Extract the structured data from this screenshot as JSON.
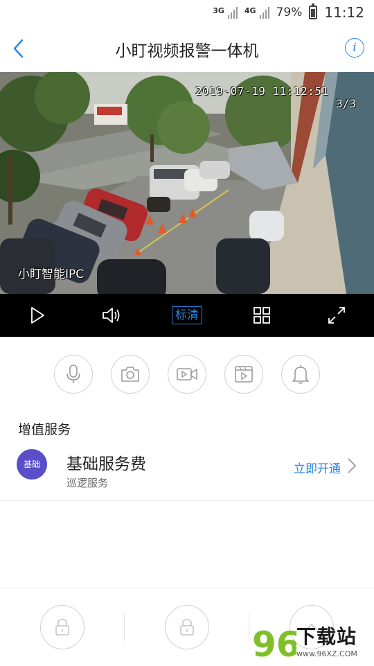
{
  "status_bar": {
    "network1": "3G",
    "network2": "4G",
    "battery": "79%",
    "time": "11:12"
  },
  "header": {
    "title": "小盯视频报警一体机",
    "info_icon": "i"
  },
  "video": {
    "timestamp": "2019-07-19  11:12:51",
    "channel": "3/3",
    "brand": "小盯智能IPC"
  },
  "controls": {
    "quality_label": "标清"
  },
  "section": {
    "title": "增值服务"
  },
  "service": {
    "badge": "基础",
    "name": "基础服务费",
    "subtitle": "巡逻服务",
    "action": "立即开通"
  },
  "watermark": {
    "digits": "96",
    "text": "下载站",
    "url": "www.96XZ.COM"
  },
  "colors": {
    "accent": "#2a85e0",
    "badge": "#5a4fc8"
  }
}
